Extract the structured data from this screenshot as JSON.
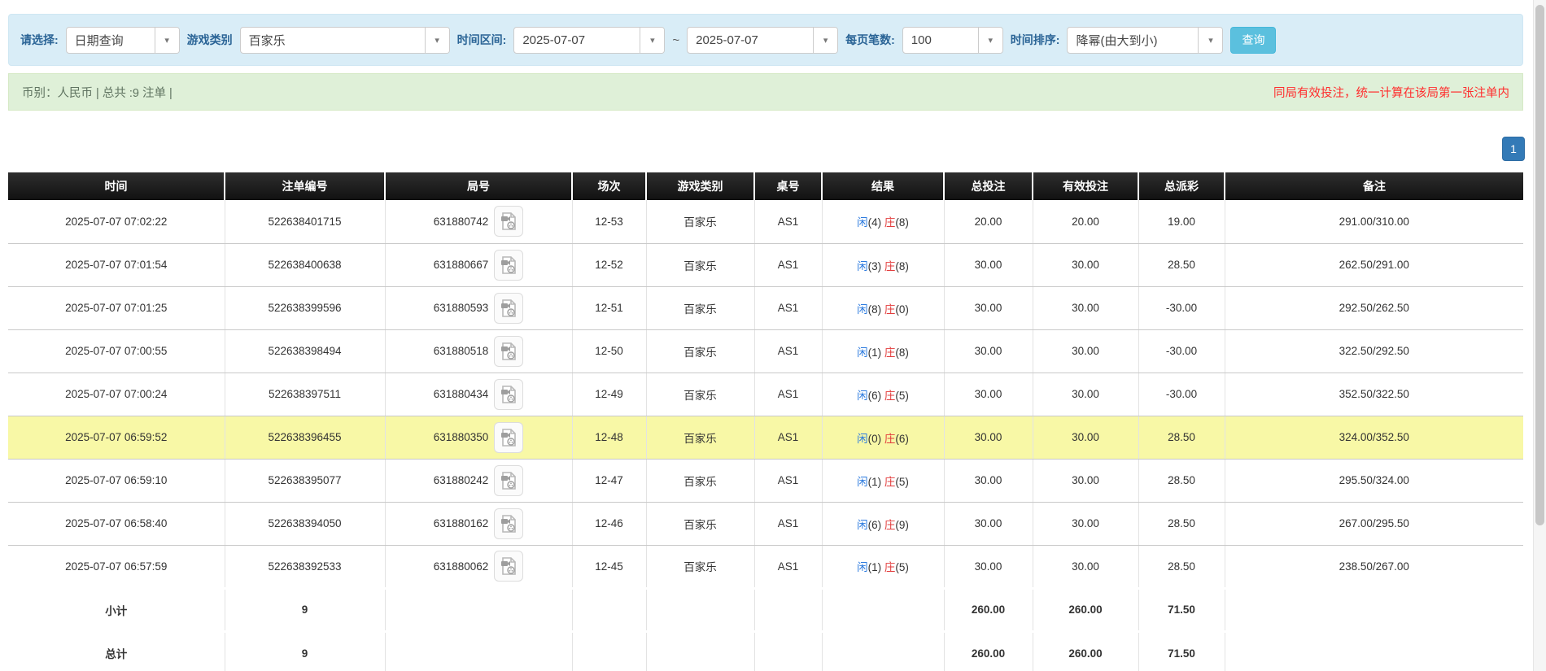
{
  "filter_bar": {
    "select_label": "请选择:",
    "select_value": "日期查询",
    "game_type_label": "游戏类别",
    "game_type_value": "百家乐",
    "time_range_label": "时间区间:",
    "time_from": "2025-07-07",
    "time_separator": "~",
    "time_to": "2025-07-07",
    "page_size_label": "每页笔数:",
    "page_size_value": "100",
    "sort_label": "时间排序:",
    "sort_value": "降幂(由大到小)",
    "search_button": "查询"
  },
  "summary_bar": {
    "left_text": "币别：人民币 | 总共 :9 注单 |",
    "right_text": "同局有效投注，统一计算在该局第一张注单内"
  },
  "pagination": {
    "current_page": "1"
  },
  "table": {
    "headers": [
      "时间",
      "注单编号",
      "局号",
      "场次",
      "游戏类别",
      "桌号",
      "结果",
      "总投注",
      "有效投注",
      "总派彩",
      "备注"
    ],
    "rows": [
      {
        "time": "2025-07-07 07:02:22",
        "bet_id": "522638401715",
        "round_id": "631880742",
        "session": "12-53",
        "game_type": "百家乐",
        "table_no": "AS1",
        "player_label": "闲",
        "player_score": "(4)",
        "banker_label": "庄",
        "banker_score": "(8)",
        "total_bet": "20.00",
        "valid_bet": "20.00",
        "payout": "19.00",
        "note": "291.00/310.00",
        "highlight": false
      },
      {
        "time": "2025-07-07 07:01:54",
        "bet_id": "522638400638",
        "round_id": "631880667",
        "session": "12-52",
        "game_type": "百家乐",
        "table_no": "AS1",
        "player_label": "闲",
        "player_score": "(3)",
        "banker_label": "庄",
        "banker_score": "(8)",
        "total_bet": "30.00",
        "valid_bet": "30.00",
        "payout": "28.50",
        "note": "262.50/291.00",
        "highlight": false
      },
      {
        "time": "2025-07-07 07:01:25",
        "bet_id": "522638399596",
        "round_id": "631880593",
        "session": "12-51",
        "game_type": "百家乐",
        "table_no": "AS1",
        "player_label": "闲",
        "player_score": "(8)",
        "banker_label": "庄",
        "banker_score": "(0)",
        "total_bet": "30.00",
        "valid_bet": "30.00",
        "payout": "-30.00",
        "note": "292.50/262.50",
        "highlight": false
      },
      {
        "time": "2025-07-07 07:00:55",
        "bet_id": "522638398494",
        "round_id": "631880518",
        "session": "12-50",
        "game_type": "百家乐",
        "table_no": "AS1",
        "player_label": "闲",
        "player_score": "(1)",
        "banker_label": "庄",
        "banker_score": "(8)",
        "total_bet": "30.00",
        "valid_bet": "30.00",
        "payout": "-30.00",
        "note": "322.50/292.50",
        "highlight": false
      },
      {
        "time": "2025-07-07 07:00:24",
        "bet_id": "522638397511",
        "round_id": "631880434",
        "session": "12-49",
        "game_type": "百家乐",
        "table_no": "AS1",
        "player_label": "闲",
        "player_score": "(6)",
        "banker_label": "庄",
        "banker_score": "(5)",
        "total_bet": "30.00",
        "valid_bet": "30.00",
        "payout": "-30.00",
        "note": "352.50/322.50",
        "highlight": false
      },
      {
        "time": "2025-07-07 06:59:52",
        "bet_id": "522638396455",
        "round_id": "631880350",
        "session": "12-48",
        "game_type": "百家乐",
        "table_no": "AS1",
        "player_label": "闲",
        "player_score": "(0)",
        "banker_label": "庄",
        "banker_score": "(6)",
        "total_bet": "30.00",
        "valid_bet": "30.00",
        "payout": "28.50",
        "note": "324.00/352.50",
        "highlight": true
      },
      {
        "time": "2025-07-07 06:59:10",
        "bet_id": "522638395077",
        "round_id": "631880242",
        "session": "12-47",
        "game_type": "百家乐",
        "table_no": "AS1",
        "player_label": "闲",
        "player_score": "(1)",
        "banker_label": "庄",
        "banker_score": "(5)",
        "total_bet": "30.00",
        "valid_bet": "30.00",
        "payout": "28.50",
        "note": "295.50/324.00",
        "highlight": false
      },
      {
        "time": "2025-07-07 06:58:40",
        "bet_id": "522638394050",
        "round_id": "631880162",
        "session": "12-46",
        "game_type": "百家乐",
        "table_no": "AS1",
        "player_label": "闲",
        "player_score": "(6)",
        "banker_label": "庄",
        "banker_score": "(9)",
        "total_bet": "30.00",
        "valid_bet": "30.00",
        "payout": "28.50",
        "note": "267.00/295.50",
        "highlight": false
      },
      {
        "time": "2025-07-07 06:57:59",
        "bet_id": "522638392533",
        "round_id": "631880062",
        "session": "12-45",
        "game_type": "百家乐",
        "table_no": "AS1",
        "player_label": "闲",
        "player_score": "(1)",
        "banker_label": "庄",
        "banker_score": "(5)",
        "total_bet": "30.00",
        "valid_bet": "30.00",
        "payout": "28.50",
        "note": "238.50/267.00",
        "highlight": false
      }
    ],
    "subtotal": {
      "label": "小计",
      "count": "9",
      "total_bet": "260.00",
      "valid_bet": "260.00",
      "payout": "71.50"
    },
    "total": {
      "label": "总计",
      "count": "9",
      "total_bet": "260.00",
      "valid_bet": "260.00",
      "payout": "71.50"
    }
  },
  "colors": {
    "filter_bar_bg": "#d9edf7",
    "search_button": "#5bc0de",
    "summary_bg": "#dff0d8",
    "notice_red": "#ff2d2d",
    "table_header_bg": "#1a1a1a",
    "highlight_row": "#f8f8a6",
    "amount_blue": "#2d7bdf",
    "negative_red": "#f02b2b",
    "player_blue": "#2d7bdf",
    "banker_red": "#e23c3c",
    "footer_bg": "#9d9d9d",
    "pagination_blue": "#337ab7"
  }
}
